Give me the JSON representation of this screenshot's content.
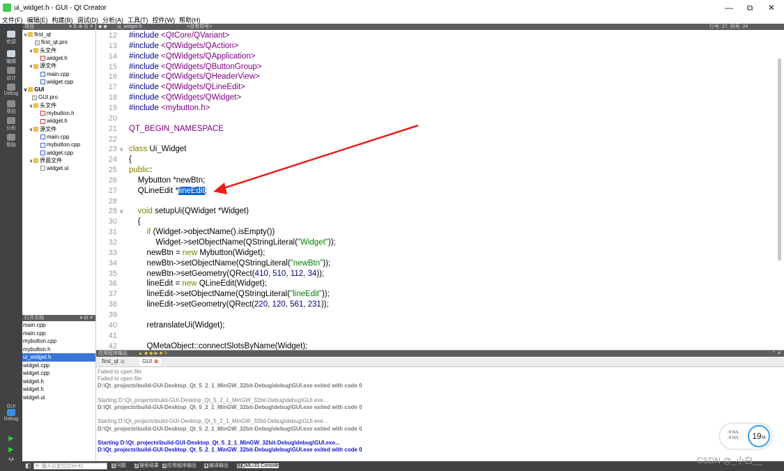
{
  "window": {
    "title": "ui_widget.h - GUI - Qt Creator",
    "minimize": "—",
    "restore": "⧉",
    "close": "✕"
  },
  "menu": [
    "文件(F)",
    "编辑(E)",
    "构建(B)",
    "调试(D)",
    "分析(A)",
    "工具(T)",
    "控件(W)",
    "帮助(H)"
  ],
  "modes": [
    "欢迎",
    "编辑",
    "设计",
    "Debug",
    "项目",
    "分析",
    "帮助"
  ],
  "kit": {
    "name": "GUI",
    "mode": "Debug"
  },
  "project_pane": {
    "title": "项目",
    "items": [
      {
        "label": "first_qt",
        "icon": "folder",
        "bold": false
      },
      {
        "label": "first_qt.pro",
        "icon": "pro"
      },
      {
        "label": "头文件",
        "icon": "folder"
      },
      {
        "label": "widget.h",
        "icon": "fileh"
      },
      {
        "label": "源文件",
        "icon": "folder"
      },
      {
        "label": "main.cpp",
        "icon": "filecpp"
      },
      {
        "label": "widget.cpp",
        "icon": "filecpp"
      },
      {
        "label": "GUI",
        "icon": "folder",
        "bold": true
      },
      {
        "label": "GUI.pro",
        "icon": "pro"
      },
      {
        "label": "头文件",
        "icon": "folder"
      },
      {
        "label": "mybutton.h",
        "icon": "fileh"
      },
      {
        "label": "widget.h",
        "icon": "fileh"
      },
      {
        "label": "源文件",
        "icon": "folder"
      },
      {
        "label": "main.cpp",
        "icon": "filecpp"
      },
      {
        "label": "mybutton.cpp",
        "icon": "filecpp"
      },
      {
        "label": "widget.cpp",
        "icon": "filecpp"
      },
      {
        "label": "界面文件",
        "icon": "folder"
      },
      {
        "label": "widget.ui",
        "icon": "ui"
      }
    ]
  },
  "open_docs": {
    "title": "打开文档",
    "items": [
      "main.cpp",
      "main.cpp",
      "mybutton.cpp",
      "mybutton.h",
      "ui_widget.h",
      "widget.cpp",
      "widget.cpp",
      "widget.h",
      "widget.h",
      "widget.ui"
    ],
    "selected": 4
  },
  "editor": {
    "file": "ui_widget.h",
    "symbol": "<没有符号>",
    "position": "行号: 27, 列号: 24",
    "lines": [
      {
        "n": "12",
        "segs": [
          [
            "cm",
            "#include "
          ],
          [
            "ma",
            "<QtCore/QVariant>"
          ]
        ]
      },
      {
        "n": "13",
        "segs": [
          [
            "cm",
            "#include "
          ],
          [
            "ma",
            "<QtWidgets/QAction>"
          ]
        ]
      },
      {
        "n": "14",
        "segs": [
          [
            "cm",
            "#include "
          ],
          [
            "ma",
            "<QtWidgets/QApplication>"
          ]
        ]
      },
      {
        "n": "15",
        "segs": [
          [
            "cm",
            "#include "
          ],
          [
            "ma",
            "<QtWidgets/QButtonGroup>"
          ]
        ]
      },
      {
        "n": "16",
        "segs": [
          [
            "cm",
            "#include "
          ],
          [
            "ma",
            "<QtWidgets/QHeaderView>"
          ]
        ]
      },
      {
        "n": "17",
        "segs": [
          [
            "cm",
            "#include "
          ],
          [
            "ma",
            "<QtWidgets/QLineEdit>"
          ]
        ]
      },
      {
        "n": "18",
        "segs": [
          [
            "cm",
            "#include "
          ],
          [
            "ma",
            "<QtWidgets/QWidget>"
          ]
        ]
      },
      {
        "n": "19",
        "segs": [
          [
            "cm",
            "#include "
          ],
          [
            "ma",
            "<mybutton.h>"
          ]
        ]
      },
      {
        "n": "20",
        "segs": []
      },
      {
        "n": "21",
        "segs": [
          [
            "ma",
            "QT_BEGIN_NAMESPACE"
          ]
        ]
      },
      {
        "n": "22",
        "segs": []
      },
      {
        "n": "23",
        "fold": true,
        "segs": [
          [
            "kw",
            "class "
          ],
          [
            "",
            "Ui_Widget"
          ]
        ]
      },
      {
        "n": "24",
        "segs": [
          [
            "",
            "{"
          ]
        ]
      },
      {
        "n": "25",
        "segs": [
          [
            "kw",
            "public"
          ],
          [
            "",
            ":"
          ]
        ]
      },
      {
        "n": "26",
        "segs": [
          [
            "",
            "    Mybutton *newBtn;"
          ]
        ]
      },
      {
        "n": "27",
        "segs": [
          [
            "",
            "    QLineEdit *"
          ],
          [
            "sel-word",
            "lineEdit"
          ],
          [
            "",
            ";"
          ]
        ]
      },
      {
        "n": "28",
        "segs": []
      },
      {
        "n": "29",
        "fold": true,
        "segs": [
          [
            "",
            "    "
          ],
          [
            "kw",
            "void"
          ],
          [
            "",
            " setupUi(QWidget *Widget)"
          ]
        ]
      },
      {
        "n": "30",
        "segs": [
          [
            "",
            "    {"
          ]
        ]
      },
      {
        "n": "31",
        "segs": [
          [
            "",
            "        "
          ],
          [
            "kw",
            "if"
          ],
          [
            "",
            " (Widget->objectName().isEmpty())"
          ]
        ]
      },
      {
        "n": "32",
        "segs": [
          [
            "",
            "            Widget->setObjectName(QStringLiteral("
          ],
          [
            "st",
            "\"Widget\""
          ],
          [
            "",
            "));"
          ]
        ]
      },
      {
        "n": "33",
        "segs": [
          [
            "",
            "        newBtn = "
          ],
          [
            "kw",
            "new"
          ],
          [
            "",
            " Mybutton(Widget);"
          ]
        ]
      },
      {
        "n": "34",
        "segs": [
          [
            "",
            "        newBtn->setObjectName(QStringLiteral("
          ],
          [
            "st",
            "\"newBtn\""
          ],
          [
            "",
            "));"
          ]
        ]
      },
      {
        "n": "35",
        "segs": [
          [
            "",
            "        newBtn->setGeometry(QRect("
          ],
          [
            "nu",
            "410"
          ],
          [
            "",
            ", "
          ],
          [
            "nu",
            "510"
          ],
          [
            "",
            ", "
          ],
          [
            "nu",
            "112"
          ],
          [
            "",
            ", "
          ],
          [
            "nu",
            "34"
          ],
          [
            "",
            "));"
          ]
        ]
      },
      {
        "n": "36",
        "segs": [
          [
            "",
            "        lineEdit = "
          ],
          [
            "kw",
            "new"
          ],
          [
            "",
            " QLineEdit(Widget);"
          ]
        ]
      },
      {
        "n": "37",
        "segs": [
          [
            "",
            "        lineEdit->setObjectName(QStringLiteral("
          ],
          [
            "st",
            "\"lineEdit\""
          ],
          [
            "",
            "));"
          ]
        ]
      },
      {
        "n": "38",
        "segs": [
          [
            "",
            "        lineEdit->setGeometry(QRect("
          ],
          [
            "nu",
            "220"
          ],
          [
            "",
            ", "
          ],
          [
            "nu",
            "120"
          ],
          [
            "",
            ", "
          ],
          [
            "nu",
            "561"
          ],
          [
            "",
            ", "
          ],
          [
            "nu",
            "231"
          ],
          [
            "",
            "));"
          ]
        ]
      },
      {
        "n": "39",
        "segs": []
      },
      {
        "n": "40",
        "segs": [
          [
            "",
            "        retranslateUi(Widget);"
          ]
        ]
      },
      {
        "n": "41",
        "segs": []
      },
      {
        "n": "42",
        "segs": [
          [
            "",
            "        QMetaObject::connectSlotsByName(Widget);"
          ]
        ]
      }
    ]
  },
  "output": {
    "title": "应用程序输出",
    "tabs": [
      "first_qt",
      "GUI"
    ],
    "active_tab": 1,
    "lines": [
      {
        "t": "Failed to open file",
        "c": "gray"
      },
      {
        "t": "Failed to open file",
        "c": "gray"
      },
      {
        "t": "D:\\Qt_projects\\build-GUI-Desktop_Qt_5_2_1_MinGW_32bit-Debug\\debug\\GUI.exe exited with code 0",
        "c": "gray-bold"
      },
      {
        "t": "",
        "c": ""
      },
      {
        "t": "Starting D:\\Qt_projects\\build-GUI-Desktop_Qt_5_2_1_MinGW_32bit-Debug\\debug\\GUI.exe...",
        "c": "gray"
      },
      {
        "t": "D:\\Qt_projects\\build-GUI-Desktop_Qt_5_2_1_MinGW_32bit-Debug\\debug\\GUI.exe exited with code 0",
        "c": "gray-bold"
      },
      {
        "t": "",
        "c": ""
      },
      {
        "t": "Starting D:\\Qt_projects\\build-GUI-Desktop_Qt_5_2_1_MinGW_32bit-Debug\\debug\\GUI.exe...",
        "c": "gray"
      },
      {
        "t": "D:\\Qt_projects\\build-GUI-Desktop_Qt_5_2_1_MinGW_32bit-Debug\\debug\\GUI.exe exited with code 0",
        "c": "gray-bold"
      },
      {
        "t": "",
        "c": ""
      },
      {
        "t": "Starting D:\\Qt_projects\\build-GUI-Desktop_Qt_5_2_1_MinGW_32bit-Debug\\debug\\GUI.exe...",
        "c": "bold-blue"
      },
      {
        "t": "D:\\Qt_projects\\build-GUI-Desktop_Qt_5_2_1_MinGW_32bit-Debug\\debug\\GUI.exe exited with code 0",
        "c": "bold-blue"
      }
    ]
  },
  "statusbar": {
    "search_placeholder": "P- 输入以定位(Ctrl+K)",
    "tabs": [
      {
        "num": "1",
        "label": "问题"
      },
      {
        "num": "2",
        "label": "搜索结果"
      },
      {
        "num": "3",
        "label": "应用程序输出"
      },
      {
        "num": "4",
        "label": "编译输出"
      },
      {
        "num": "5",
        "label": "QML/JS Console",
        "active": true
      }
    ]
  },
  "network_widget": {
    "up": "0 K/s",
    "down": "0 K/s",
    "percent": "19",
    "unit": "%"
  },
  "watermark": "CSDN @_小白__",
  "colors": {
    "sidebar": "#404244",
    "selection": "#0a64d0",
    "arrow": "#e8201a"
  }
}
